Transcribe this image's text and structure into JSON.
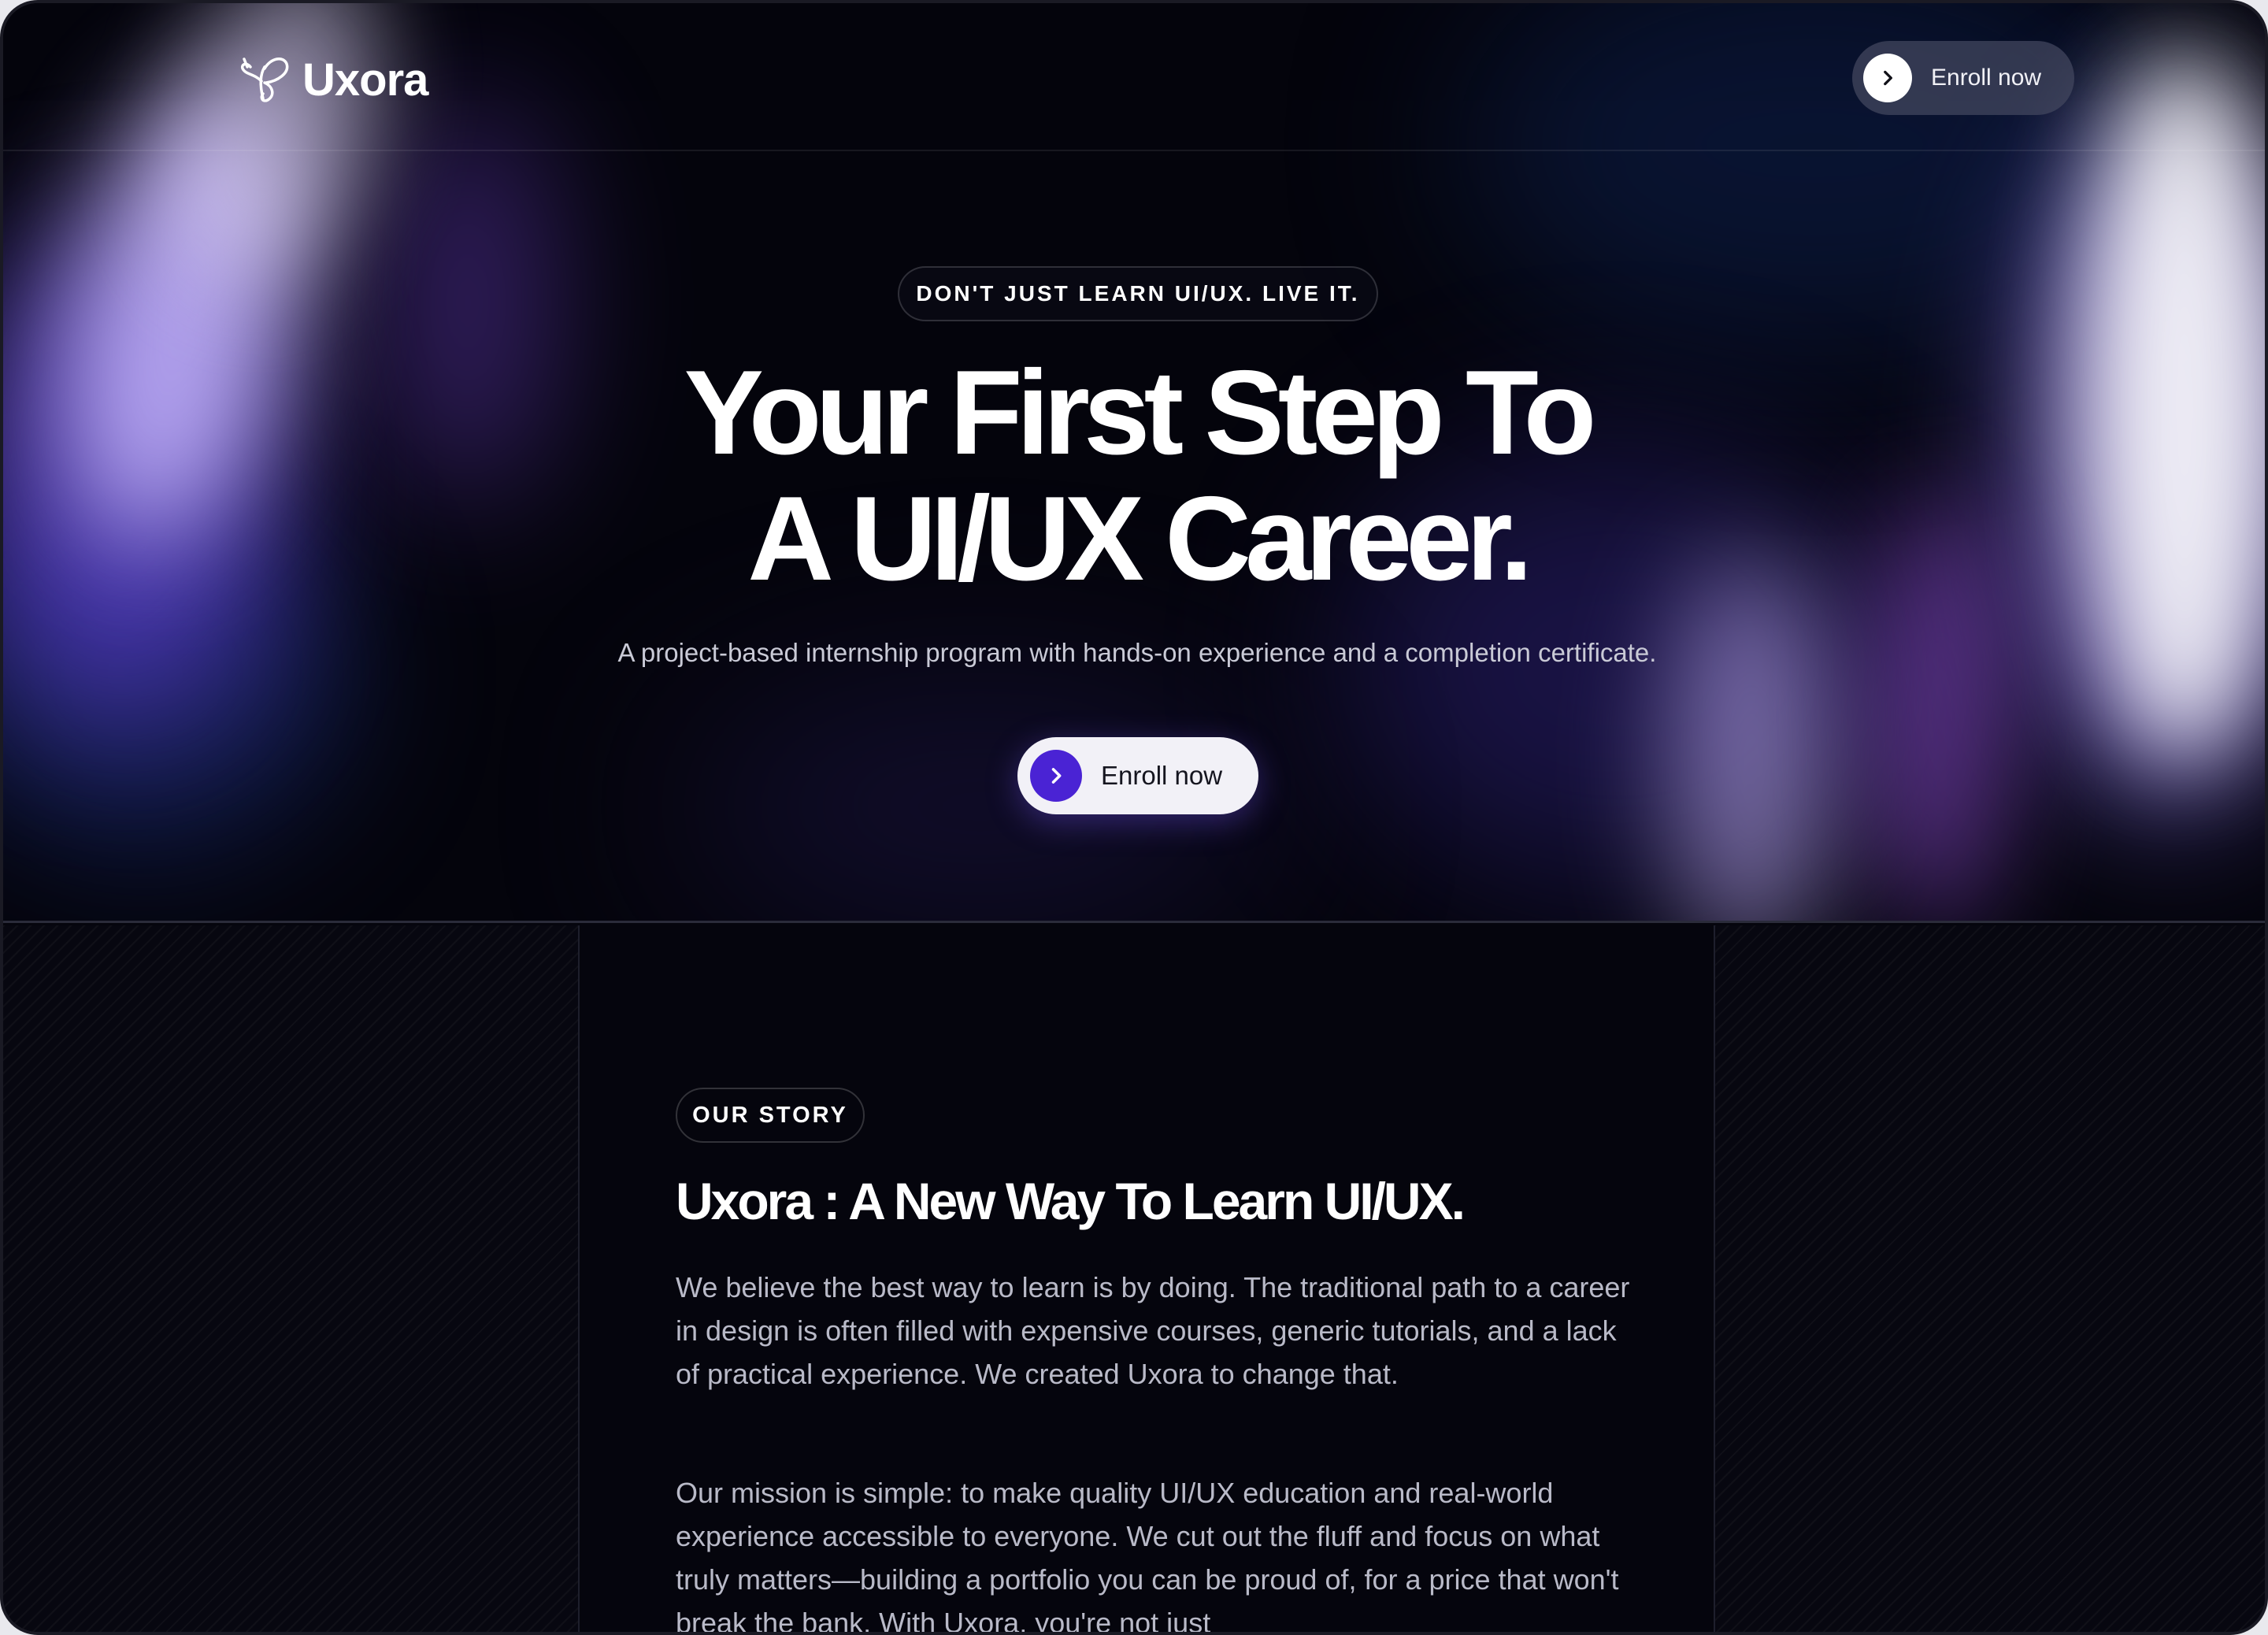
{
  "brand": {
    "name": "Uxora"
  },
  "nav": {
    "enroll_label": "Enroll now"
  },
  "hero": {
    "tagline": "DON'T JUST LEARN UI/UX. LIVE IT.",
    "headline_line1": "Your First Step To",
    "headline_line2": "A UI/UX Career.",
    "subtitle": "A project-based internship program with hands-on experience and a completion certificate.",
    "cta_label": "Enroll now"
  },
  "story": {
    "badge": "OUR STORY",
    "title": "Uxora : A New Way To Learn UI/UX.",
    "paragraph1": "We believe the best way to learn is by doing. The traditional path to a career in design is often filled with expensive courses, generic tutorials, and a lack of practical experience. We created Uxora to change that.",
    "paragraph2": "Our mission is simple: to make quality UI/UX education and real-world experience accessible to everyone. We cut out the fluff and focus on what truly matters—building a portfolio you can be proud of, for a price that won't break the bank. With Uxora, you're not just"
  },
  "colors": {
    "accent": "#4a23d4",
    "background": "#05050d",
    "text_primary": "#ffffff",
    "text_muted": "#b9bac8"
  },
  "icons": {
    "logo": "butterfly-icon",
    "nav_button": "chevron-right-icon",
    "hero_button": "chevron-right-icon"
  }
}
